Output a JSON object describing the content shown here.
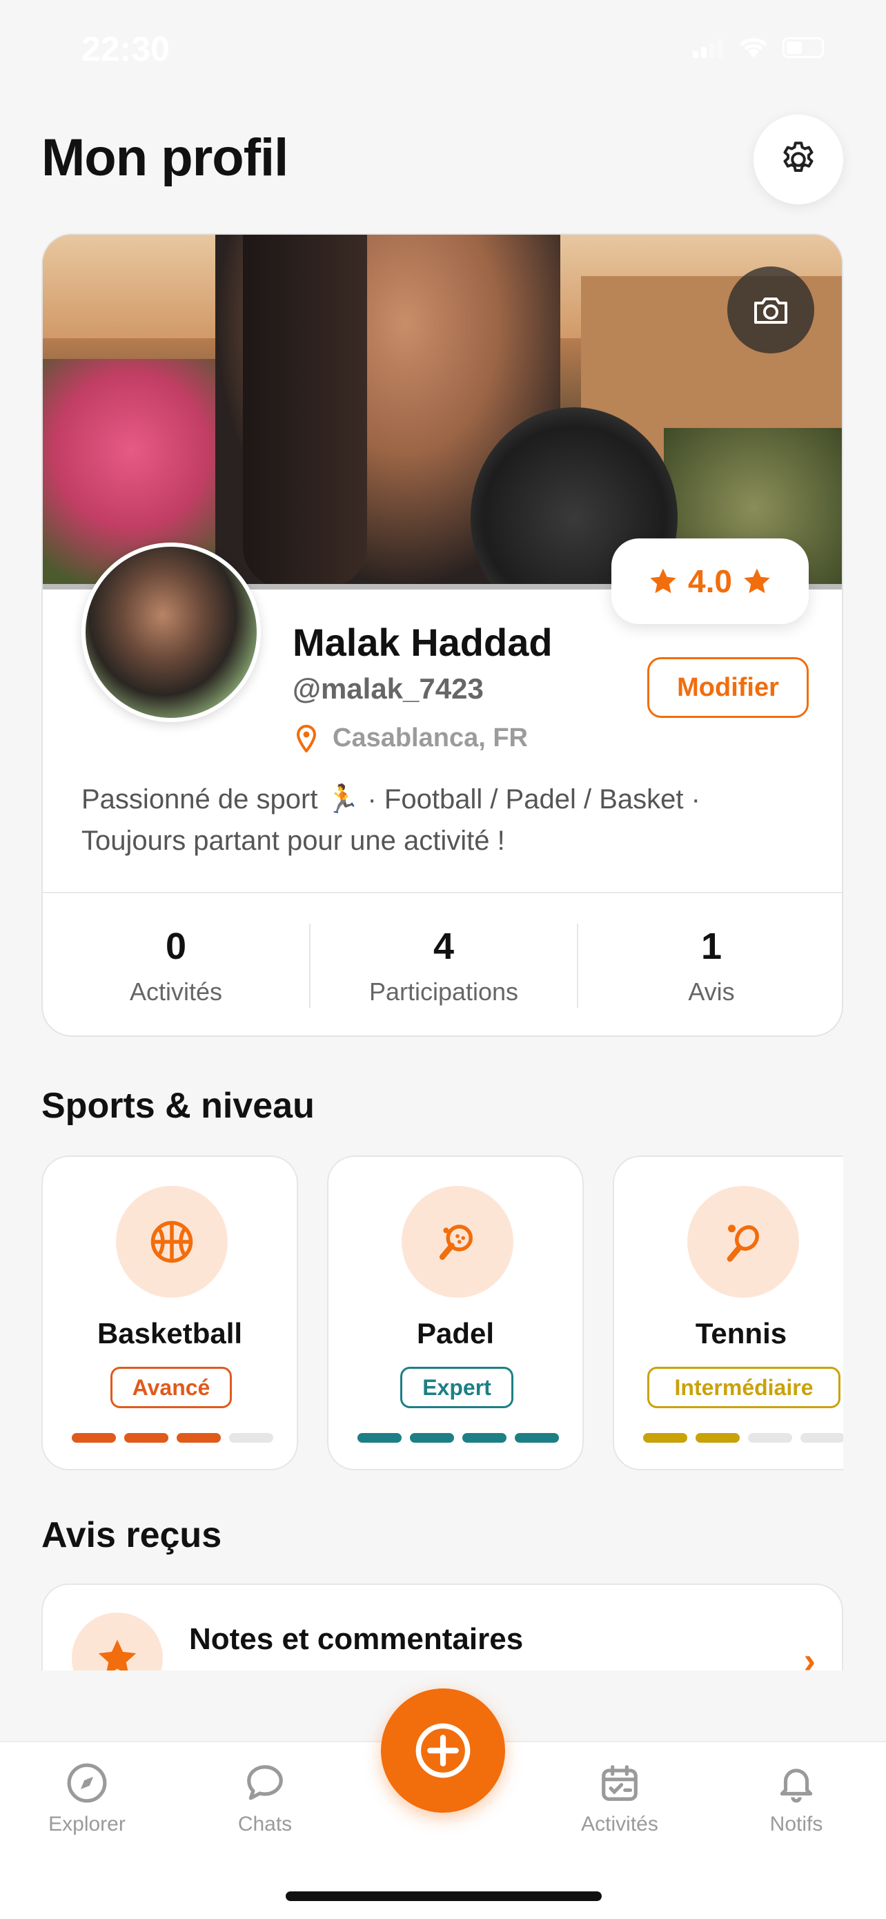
{
  "status_bar": {
    "time": "22:30"
  },
  "header": {
    "title": "Mon profil",
    "settings_icon": "gear-icon"
  },
  "profile": {
    "name": "Malak Haddad",
    "handle": "@malak_7423",
    "location": "Casablanca, FR",
    "rating": "4.0",
    "edit_label": "Modifier",
    "bio_line1": "Passionné de sport 🏃 · Football / Padel / Basket ·",
    "bio_line2": "Toujours partant pour une activité !"
  },
  "stats": [
    {
      "value": "0",
      "label": "Activités"
    },
    {
      "value": "4",
      "label": "Participations"
    },
    {
      "value": "1",
      "label": "Avis"
    }
  ],
  "sports_section": {
    "title": "Sports & niveau",
    "items": [
      {
        "name": "Basketball",
        "level": "Avancé",
        "level_value": 3,
        "level_max": 4,
        "color": "#e05a1c",
        "icon": "basketball-icon"
      },
      {
        "name": "Padel",
        "level": "Expert",
        "level_value": 4,
        "level_max": 4,
        "color": "#1d7f86",
        "icon": "padel-icon"
      },
      {
        "name": "Tennis",
        "level": "Intermédiaire",
        "level_value": 2,
        "level_max": 4,
        "color": "#c9a20a",
        "icon": "tennis-icon"
      }
    ]
  },
  "reviews_section": {
    "title": "Avis reçus",
    "card_title": "Notes et commentaires"
  },
  "tabbar": {
    "explore": "Explorer",
    "chats": "Chats",
    "activities": "Activités",
    "notifs": "Notifs"
  },
  "colors": {
    "accent": "#f26d0c",
    "background": "#f6f6f6"
  }
}
